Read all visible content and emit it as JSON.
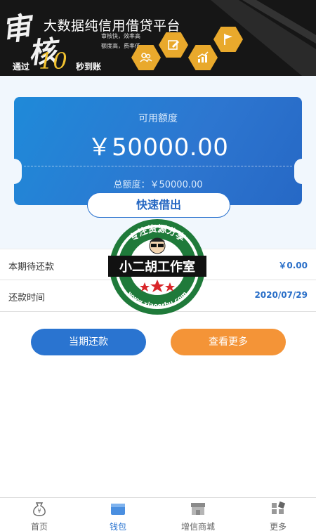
{
  "banner": {
    "brush_char_1": "审",
    "brush_char_2": "核",
    "title": "大数据纯信用借贷平台",
    "subtitle_1": "审核快，效率高",
    "subtitle_2": "额度高，费率低",
    "through": "通过",
    "ten": "10",
    "arrive": "秒到账"
  },
  "card": {
    "available_label": "可用额度",
    "available_amount": "￥50000.00",
    "total_label": "总额度：￥50000.00",
    "borrow_button": "快速借出"
  },
  "info": {
    "due_label": "本期待还款",
    "due_value": "￥0.00",
    "date_label": "还款时间",
    "date_value": "2020/07/29"
  },
  "watermark": {
    "top_text": "专注资源分享",
    "center_text": "小二胡工作室",
    "bottom_text": "www.xiaoerhu.com"
  },
  "actions": {
    "repay_label": "当期还款",
    "more_label": "查看更多"
  },
  "nav": {
    "items": [
      {
        "label": "首页",
        "icon": "money-bag-icon"
      },
      {
        "label": "钱包",
        "icon": "wallet-icon"
      },
      {
        "label": "增信商城",
        "icon": "store-icon"
      },
      {
        "label": "更多",
        "icon": "grid-more-icon"
      }
    ],
    "active_index": 1
  },
  "colors": {
    "primary_blue": "#2a74d0",
    "accent_orange": "#f49437",
    "banner_gold": "#e9a92c"
  }
}
